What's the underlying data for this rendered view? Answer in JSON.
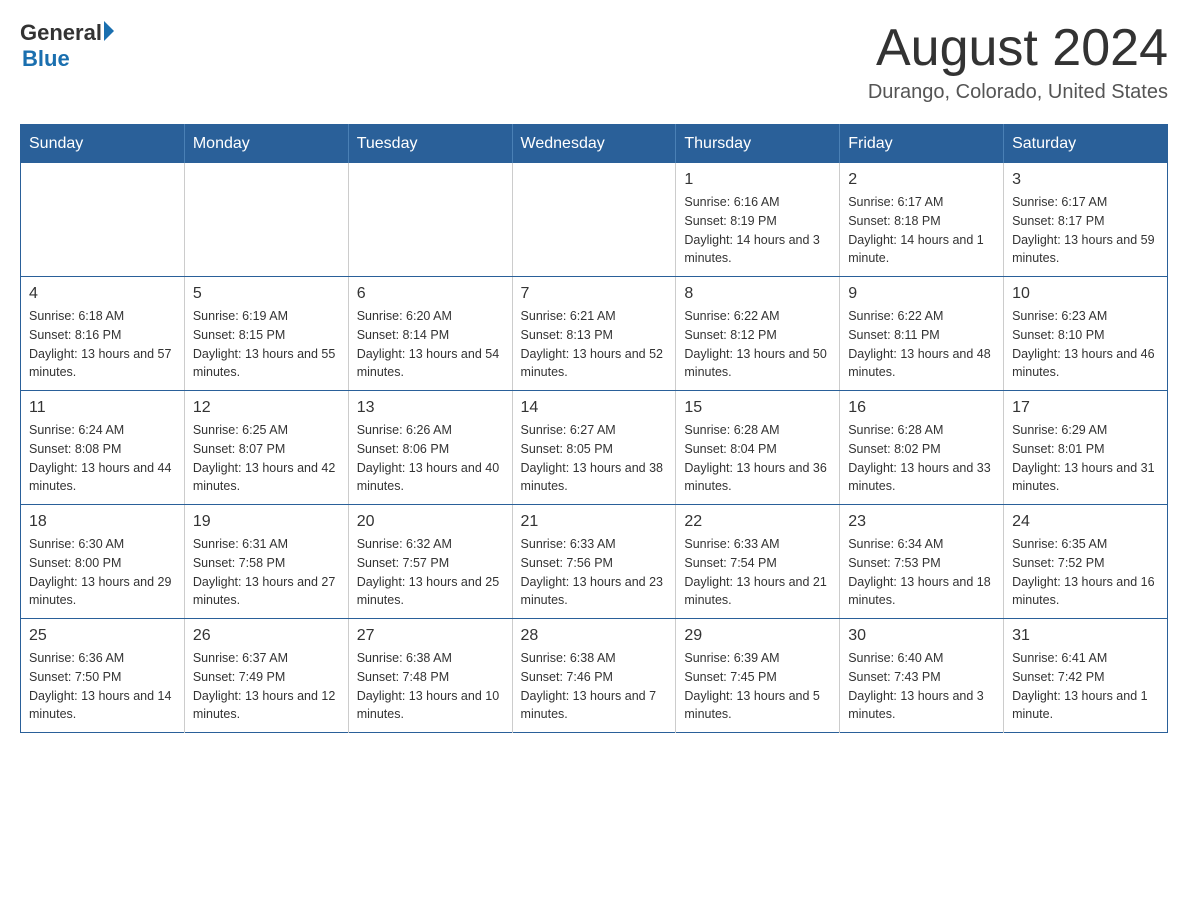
{
  "logo": {
    "text_general": "General",
    "text_blue": "Blue",
    "line2": "Blue"
  },
  "header": {
    "month_title": "August 2024",
    "location": "Durango, Colorado, United States"
  },
  "weekdays": [
    "Sunday",
    "Monday",
    "Tuesday",
    "Wednesday",
    "Thursday",
    "Friday",
    "Saturday"
  ],
  "weeks": [
    [
      {
        "day": "",
        "info": ""
      },
      {
        "day": "",
        "info": ""
      },
      {
        "day": "",
        "info": ""
      },
      {
        "day": "",
        "info": ""
      },
      {
        "day": "1",
        "info": "Sunrise: 6:16 AM\nSunset: 8:19 PM\nDaylight: 14 hours and 3 minutes."
      },
      {
        "day": "2",
        "info": "Sunrise: 6:17 AM\nSunset: 8:18 PM\nDaylight: 14 hours and 1 minute."
      },
      {
        "day": "3",
        "info": "Sunrise: 6:17 AM\nSunset: 8:17 PM\nDaylight: 13 hours and 59 minutes."
      }
    ],
    [
      {
        "day": "4",
        "info": "Sunrise: 6:18 AM\nSunset: 8:16 PM\nDaylight: 13 hours and 57 minutes."
      },
      {
        "day": "5",
        "info": "Sunrise: 6:19 AM\nSunset: 8:15 PM\nDaylight: 13 hours and 55 minutes."
      },
      {
        "day": "6",
        "info": "Sunrise: 6:20 AM\nSunset: 8:14 PM\nDaylight: 13 hours and 54 minutes."
      },
      {
        "day": "7",
        "info": "Sunrise: 6:21 AM\nSunset: 8:13 PM\nDaylight: 13 hours and 52 minutes."
      },
      {
        "day": "8",
        "info": "Sunrise: 6:22 AM\nSunset: 8:12 PM\nDaylight: 13 hours and 50 minutes."
      },
      {
        "day": "9",
        "info": "Sunrise: 6:22 AM\nSunset: 8:11 PM\nDaylight: 13 hours and 48 minutes."
      },
      {
        "day": "10",
        "info": "Sunrise: 6:23 AM\nSunset: 8:10 PM\nDaylight: 13 hours and 46 minutes."
      }
    ],
    [
      {
        "day": "11",
        "info": "Sunrise: 6:24 AM\nSunset: 8:08 PM\nDaylight: 13 hours and 44 minutes."
      },
      {
        "day": "12",
        "info": "Sunrise: 6:25 AM\nSunset: 8:07 PM\nDaylight: 13 hours and 42 minutes."
      },
      {
        "day": "13",
        "info": "Sunrise: 6:26 AM\nSunset: 8:06 PM\nDaylight: 13 hours and 40 minutes."
      },
      {
        "day": "14",
        "info": "Sunrise: 6:27 AM\nSunset: 8:05 PM\nDaylight: 13 hours and 38 minutes."
      },
      {
        "day": "15",
        "info": "Sunrise: 6:28 AM\nSunset: 8:04 PM\nDaylight: 13 hours and 36 minutes."
      },
      {
        "day": "16",
        "info": "Sunrise: 6:28 AM\nSunset: 8:02 PM\nDaylight: 13 hours and 33 minutes."
      },
      {
        "day": "17",
        "info": "Sunrise: 6:29 AM\nSunset: 8:01 PM\nDaylight: 13 hours and 31 minutes."
      }
    ],
    [
      {
        "day": "18",
        "info": "Sunrise: 6:30 AM\nSunset: 8:00 PM\nDaylight: 13 hours and 29 minutes."
      },
      {
        "day": "19",
        "info": "Sunrise: 6:31 AM\nSunset: 7:58 PM\nDaylight: 13 hours and 27 minutes."
      },
      {
        "day": "20",
        "info": "Sunrise: 6:32 AM\nSunset: 7:57 PM\nDaylight: 13 hours and 25 minutes."
      },
      {
        "day": "21",
        "info": "Sunrise: 6:33 AM\nSunset: 7:56 PM\nDaylight: 13 hours and 23 minutes."
      },
      {
        "day": "22",
        "info": "Sunrise: 6:33 AM\nSunset: 7:54 PM\nDaylight: 13 hours and 21 minutes."
      },
      {
        "day": "23",
        "info": "Sunrise: 6:34 AM\nSunset: 7:53 PM\nDaylight: 13 hours and 18 minutes."
      },
      {
        "day": "24",
        "info": "Sunrise: 6:35 AM\nSunset: 7:52 PM\nDaylight: 13 hours and 16 minutes."
      }
    ],
    [
      {
        "day": "25",
        "info": "Sunrise: 6:36 AM\nSunset: 7:50 PM\nDaylight: 13 hours and 14 minutes."
      },
      {
        "day": "26",
        "info": "Sunrise: 6:37 AM\nSunset: 7:49 PM\nDaylight: 13 hours and 12 minutes."
      },
      {
        "day": "27",
        "info": "Sunrise: 6:38 AM\nSunset: 7:48 PM\nDaylight: 13 hours and 10 minutes."
      },
      {
        "day": "28",
        "info": "Sunrise: 6:38 AM\nSunset: 7:46 PM\nDaylight: 13 hours and 7 minutes."
      },
      {
        "day": "29",
        "info": "Sunrise: 6:39 AM\nSunset: 7:45 PM\nDaylight: 13 hours and 5 minutes."
      },
      {
        "day": "30",
        "info": "Sunrise: 6:40 AM\nSunset: 7:43 PM\nDaylight: 13 hours and 3 minutes."
      },
      {
        "day": "31",
        "info": "Sunrise: 6:41 AM\nSunset: 7:42 PM\nDaylight: 13 hours and 1 minute."
      }
    ]
  ]
}
